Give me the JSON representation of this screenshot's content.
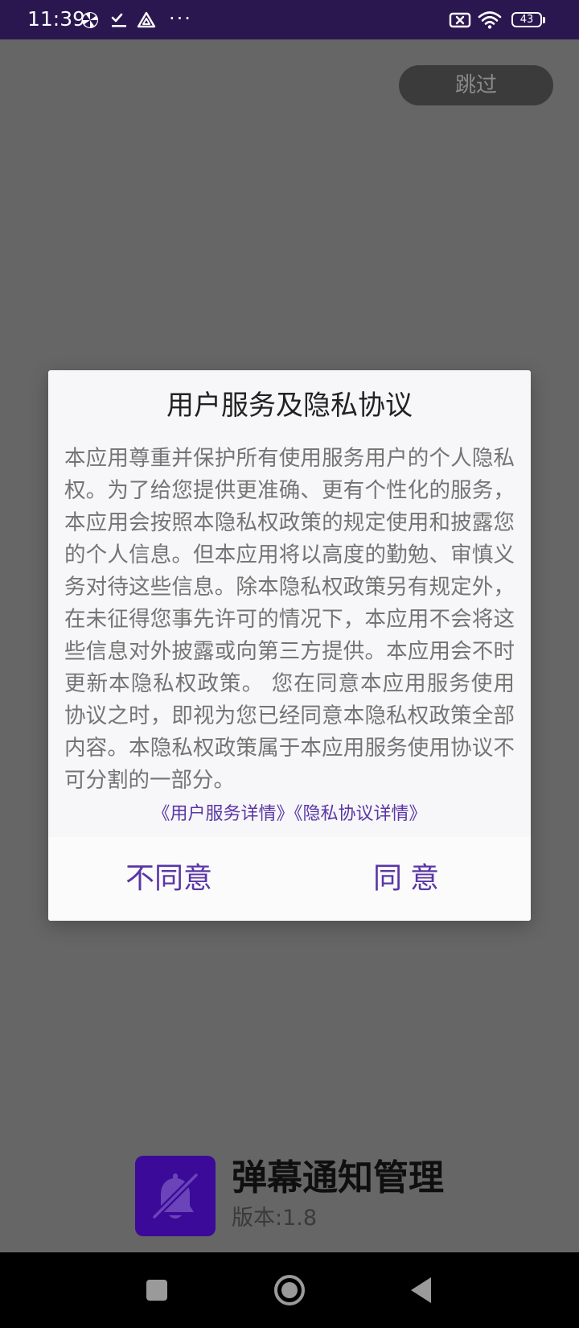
{
  "status_bar": {
    "time": "11:39",
    "battery_level": "43",
    "icons": [
      "pinwheel-icon",
      "checklist-icon",
      "drive-icon",
      "more-dots-icon",
      "sim-off-icon",
      "wifi-icon",
      "battery-icon"
    ],
    "dots": "···"
  },
  "skip_button": {
    "label": "跳过"
  },
  "dialog": {
    "title": "用户服务及隐私协议",
    "body": "本应用尊重并保护所有使用服务用户的个人隐私权。为了给您提供更准确、更有个性化的服务，本应用会按照本隐私权政策的规定使用和披露您的个人信息。但本应用将以高度的勤勉、审慎义务对待这些信息。除本隐私权政策另有规定外，在未征得您事先许可的情况下，本应用不会将这些信息对外披露或向第三方提供。本应用会不时更新本隐私权政策。 您在同意本应用服务使用协议之时，即视为您已经同意本隐私权政策全部内容。本隐私权政策属于本应用服务使用协议不可分割的一部分。",
    "link_user_service": "《用户服务详情》",
    "link_privacy": "《隐私协议详情》",
    "disagree_label": "不同意",
    "agree_label": "同意"
  },
  "app_info": {
    "name": "弹幕通知管理",
    "version": "版本:1.8",
    "icon": "bell-off-icon"
  },
  "nav_bar": {
    "buttons": [
      "recents-icon",
      "home-icon",
      "back-icon"
    ]
  },
  "colors": {
    "status_bar_bg": "#2a1750",
    "overlay_bg": "#666666",
    "accent": "#5a36a6",
    "app_icon_bg": "#3b0a99"
  }
}
